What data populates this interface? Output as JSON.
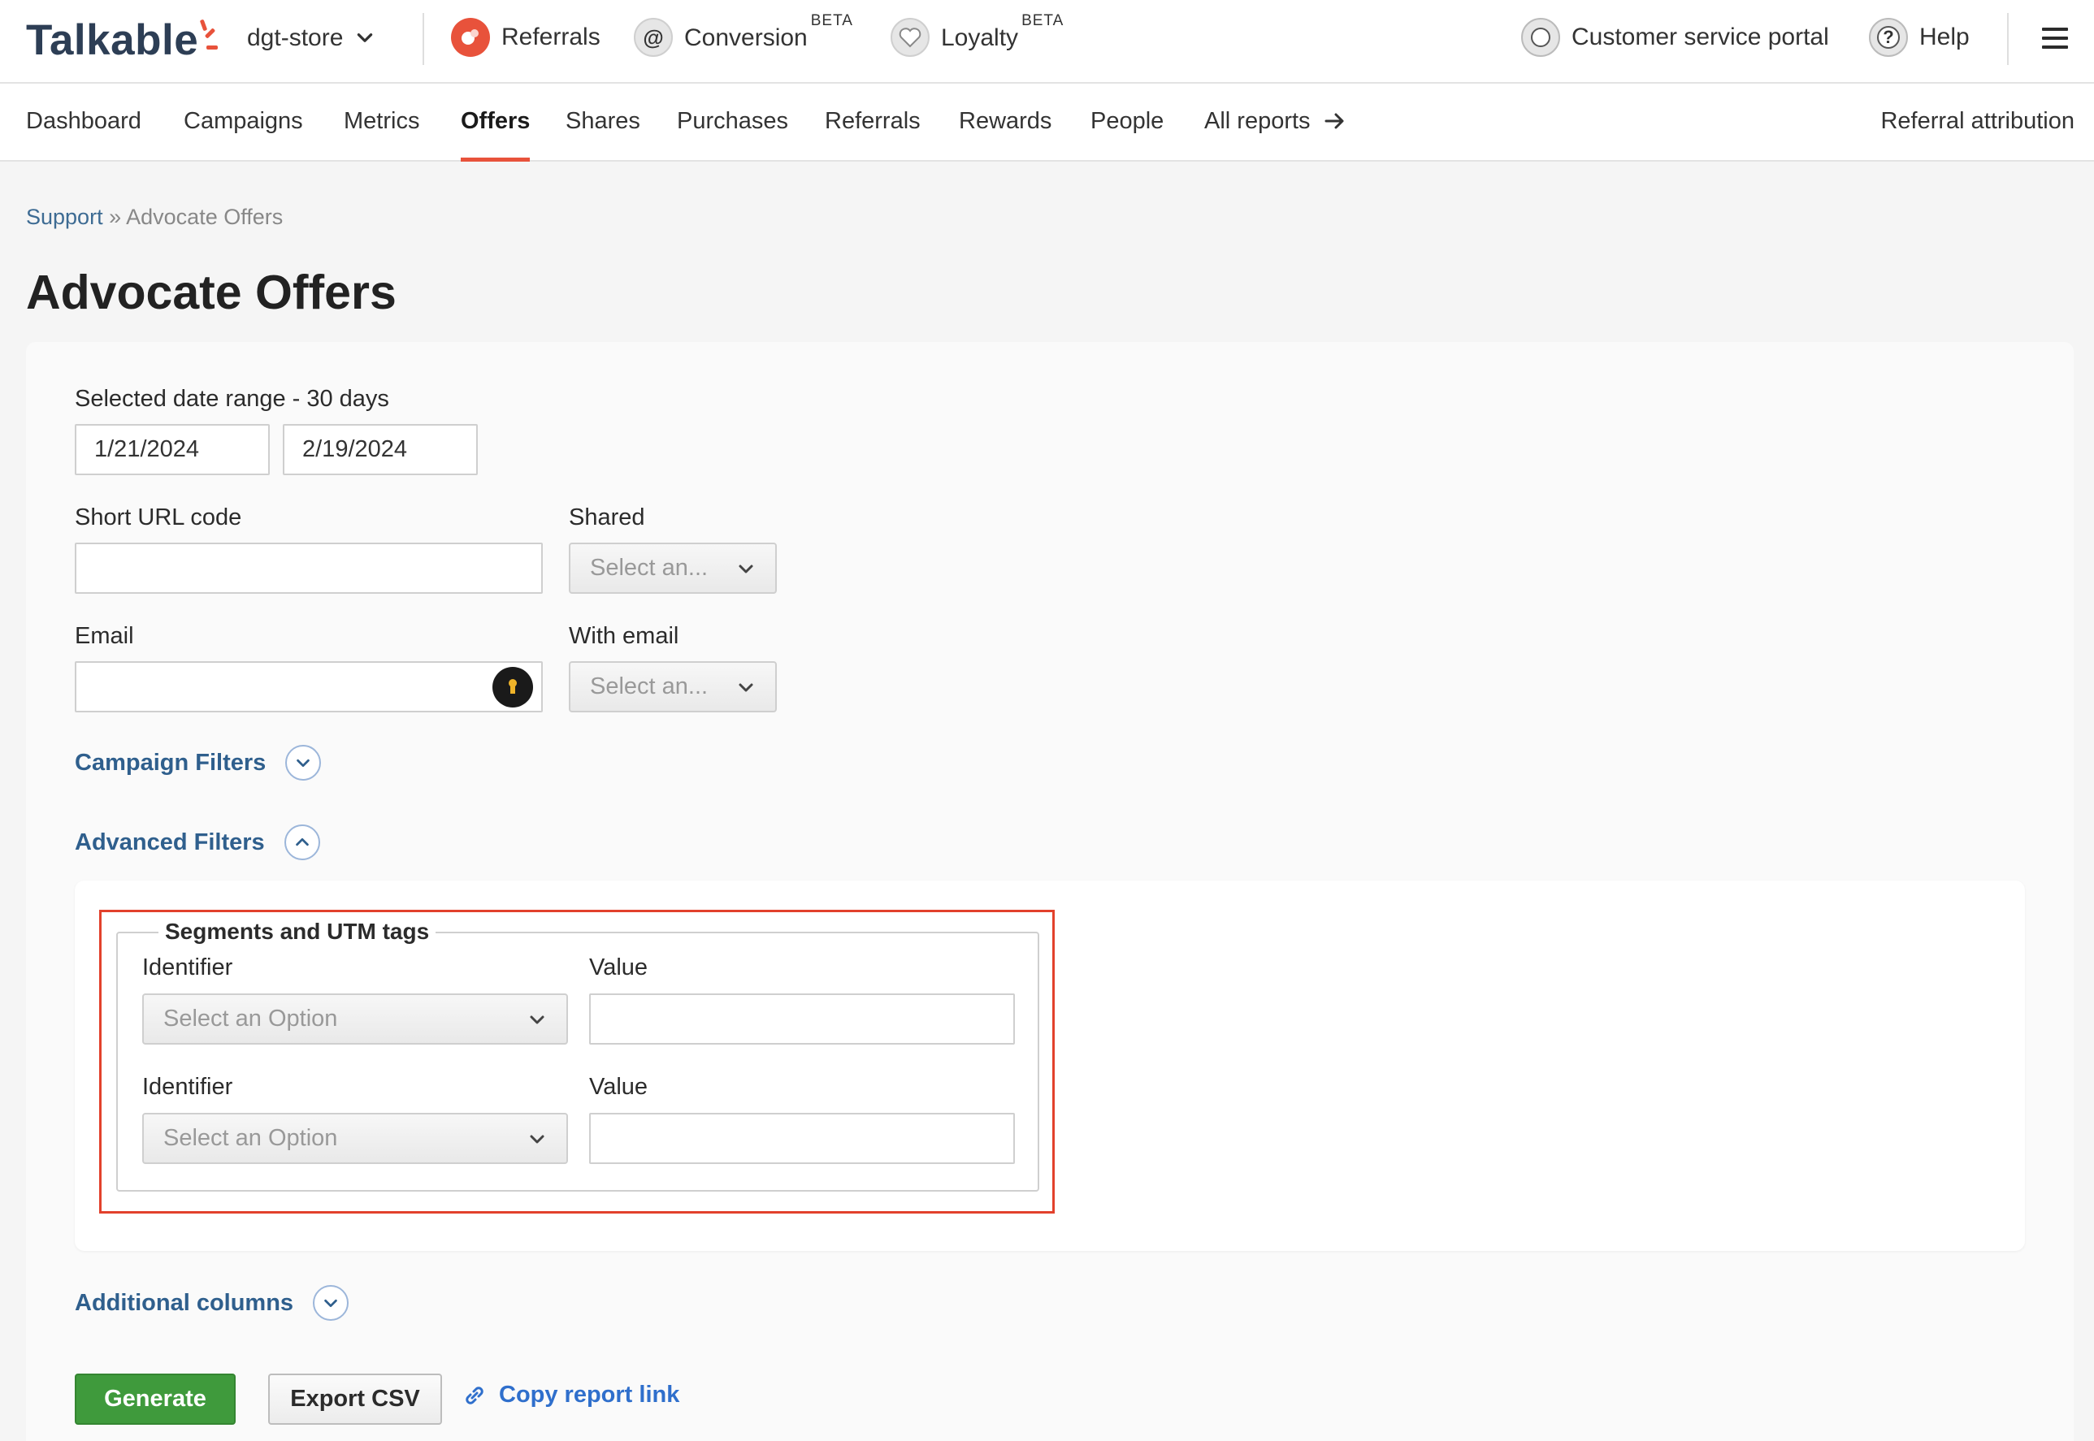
{
  "header": {
    "logo_text": "Talkable",
    "store_name": "dgt-store",
    "products": [
      {
        "label": "Referrals",
        "badge": "",
        "icon": "referrals-icon"
      },
      {
        "label": "Conversion",
        "badge": "BETA",
        "icon": "at-sign-icon"
      },
      {
        "label": "Loyalty",
        "badge": "BETA",
        "icon": "heart-icon"
      }
    ],
    "customer_service": "Customer service portal",
    "help": "Help",
    "accent_color": "#e8523b"
  },
  "nav": {
    "items": [
      "Dashboard",
      "Campaigns",
      "Metrics",
      "Offers",
      "Shares",
      "Purchases",
      "Referrals",
      "Rewards",
      "People",
      "All reports"
    ],
    "active": "Offers",
    "right_link": "Referral attribution"
  },
  "breadcrumb": {
    "root": "Support",
    "separator": "»",
    "current": "Advocate Offers"
  },
  "page_title": "Advocate Offers",
  "form": {
    "date_range_label": "Selected date range - 30 days",
    "date_from": "1/21/2024",
    "date_to": "2/19/2024",
    "short_url_label": "Short URL code",
    "short_url_value": "",
    "shared_label": "Shared",
    "shared_placeholder": "Select an...",
    "email_label": "Email",
    "email_value": "",
    "with_email_label": "With email",
    "with_email_placeholder": "Select an...",
    "campaign_filters": "Campaign Filters",
    "advanced_filters": "Advanced Filters",
    "segments": {
      "legend": "Segments and UTM tags",
      "rows": [
        {
          "identifier_label": "Identifier",
          "identifier_placeholder": "Select an Option",
          "value_label": "Value",
          "value": ""
        },
        {
          "identifier_label": "Identifier",
          "identifier_placeholder": "Select an Option",
          "value_label": "Value",
          "value": ""
        }
      ]
    },
    "additional_columns": "Additional columns"
  },
  "actions": {
    "generate": "Generate",
    "export_csv": "Export CSV",
    "copy_link": "Copy report link"
  }
}
